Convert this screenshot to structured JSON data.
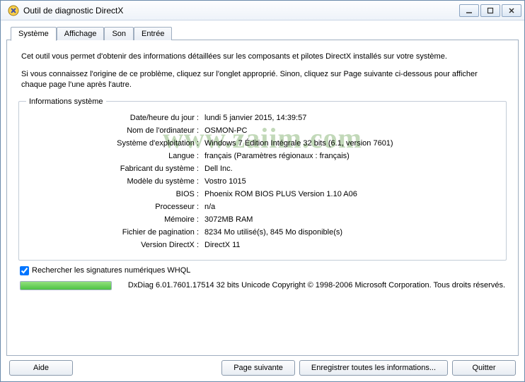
{
  "window": {
    "title": "Outil de diagnostic DirectX"
  },
  "tabs": [
    {
      "label": "Système"
    },
    {
      "label": "Affichage"
    },
    {
      "label": "Son"
    },
    {
      "label": "Entrée"
    }
  ],
  "intro": {
    "p1": "Cet outil vous permet d'obtenir des informations détaillées sur les composants et pilotes DirectX installés sur votre système.",
    "p2": "Si vous connaissez l'origine de ce problème, cliquez sur l'onglet approprié. Sinon, cliquez sur Page suivante ci-dessous pour afficher chaque page l'une après l'autre."
  },
  "watermark": "www.zaiim.com",
  "group": {
    "legend": "Informations système"
  },
  "info": [
    {
      "label": "Date/heure du jour :",
      "value": "lundi 5 janvier 2015, 14:39:57"
    },
    {
      "label": "Nom de l'ordinateur :",
      "value": "OSMON-PC"
    },
    {
      "label": "Système d'exploitation :",
      "value": "Windows 7 Édition Intégrale 32 bits (6.1, version 7601)"
    },
    {
      "label": "Langue :",
      "value": "français (Paramètres régionaux : français)"
    },
    {
      "label": "Fabricant du système :",
      "value": "Dell Inc."
    },
    {
      "label": "Modèle du système :",
      "value": "Vostro 1015"
    },
    {
      "label": "BIOS :",
      "value": "Phoenix ROM BIOS PLUS Version 1.10 A06"
    },
    {
      "label": "Processeur :",
      "value": "n/a"
    },
    {
      "label": "Mémoire :",
      "value": "3072MB RAM"
    },
    {
      "label": "Fichier de pagination :",
      "value": "8234 Mo utilisé(s), 845 Mo disponible(s)"
    },
    {
      "label": "Version DirectX :",
      "value": "DirectX 11"
    }
  ],
  "whql": {
    "label": "Rechercher les signatures numériques WHQL",
    "checked": true
  },
  "copyright": "DxDiag 6.01.7601.17514 32 bits Unicode Copyright © 1998-2006 Microsoft Corporation. Tous droits réservés.",
  "buttons": {
    "help": "Aide",
    "next": "Page suivante",
    "save": "Enregistrer toutes les informations...",
    "quit": "Quitter"
  }
}
